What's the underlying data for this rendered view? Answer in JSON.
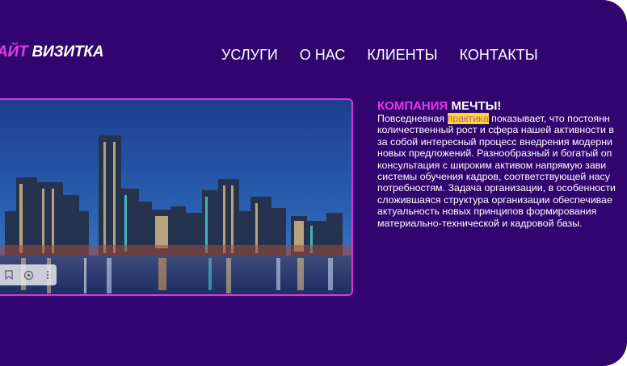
{
  "logo": {
    "part1": "АЙТ",
    "part2": "ВИЗИТКА"
  },
  "nav": {
    "items": [
      "УСЛУГИ",
      "О НАС",
      "КЛИЕНТЫ",
      "КОНТАКТЫ"
    ]
  },
  "hero_image": {
    "alt": "Ночной вид города с небоскрёбами у воды"
  },
  "photo_tools": {
    "icons": [
      "bookmark-icon",
      "lens-icon",
      "more-icon"
    ]
  },
  "content": {
    "heading_accent": "КОМПАНИЯ",
    "heading_rest": "МЕЧТЫ!",
    "lines": [
      {
        "pre": "Повседневная ",
        "highlight": "практика",
        "post": " показывает, что постоянн"
      },
      {
        "text": "количественный рост и сфера нашей активности в"
      },
      {
        "text": "за собой интересный процесс внедрения модерни"
      },
      {
        "text": "новых предложений. Разнообразный и богатый оп"
      },
      {
        "text": "консультация с широким активом напрямую зави"
      },
      {
        "text": "системы обучения кадров, соответствующей насу"
      },
      {
        "text": "потребностям. Задача организации, в особенности"
      },
      {
        "text": "сложившаяся структура организации обеспечивае"
      },
      {
        "text": "актуальность новых принципов формирования"
      },
      {
        "text": "материально-технической и кадровой базы."
      }
    ]
  },
  "colors": {
    "background": "#32046f",
    "accent": "#e23ae8",
    "highlight": "#f4de22"
  }
}
